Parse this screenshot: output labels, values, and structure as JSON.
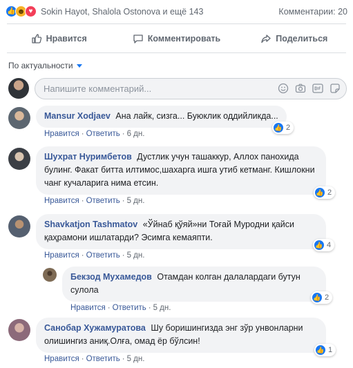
{
  "summary": {
    "reactions": [
      "like-icon",
      "haha-icon",
      "love-icon"
    ],
    "reactors": "Sokin Hayot, Shalola Ostonova и ещё 143",
    "comment_count": "Комментарии: 20"
  },
  "actions": {
    "like": "Нравится",
    "comment": "Комментировать",
    "share": "Поделиться"
  },
  "sort_label": "По актуальности",
  "composer": {
    "placeholder": "Напишите комментарий...",
    "tools": [
      "emoji-icon",
      "camera-icon",
      "gif-icon",
      "sticker-icon"
    ]
  },
  "meta_labels": {
    "like": "Нравится",
    "reply": "Ответить",
    "sep": "·"
  },
  "comments": [
    {
      "author": "Mansur Xodjaev",
      "text": "Ана лайк, сизга... Буюклик оддийликда...",
      "time": "6 дн.",
      "likes": "2"
    },
    {
      "author": "Шухрат Нуримбетов",
      "text": "Дустлик учун ташаккур, Аллох панохида булинг. Факат битта илтимос,шахарга ишга утиб кетманг. Кишлокни чанг кучаларига нима етсин.",
      "time": "5 дн.",
      "likes": "2"
    },
    {
      "author": "Shavkatjon Tashmatov",
      "text": "«Ўйнаб қўяй»ни Тоғай Муродни қайси қаҳрамони ишлатарди? Эсимга кемаяпти.",
      "time": "5 дн.",
      "likes": "4"
    },
    {
      "author": "Бекзод Мухамедов",
      "text": "Отамдан колган далалардаги бутун сулола",
      "time": "5 дн.",
      "likes": "2"
    },
    {
      "author": "Санобар Хужамуратова",
      "text": "Шу боришингизда энг зўр унвонларни олишингиз аниқ.Олға, омад ёр бўлсин!",
      "time": "5 дн.",
      "likes": "1"
    }
  ],
  "colors": {
    "accent": "#1877f2",
    "link": "#385898",
    "bubble": "#f2f3f5"
  }
}
